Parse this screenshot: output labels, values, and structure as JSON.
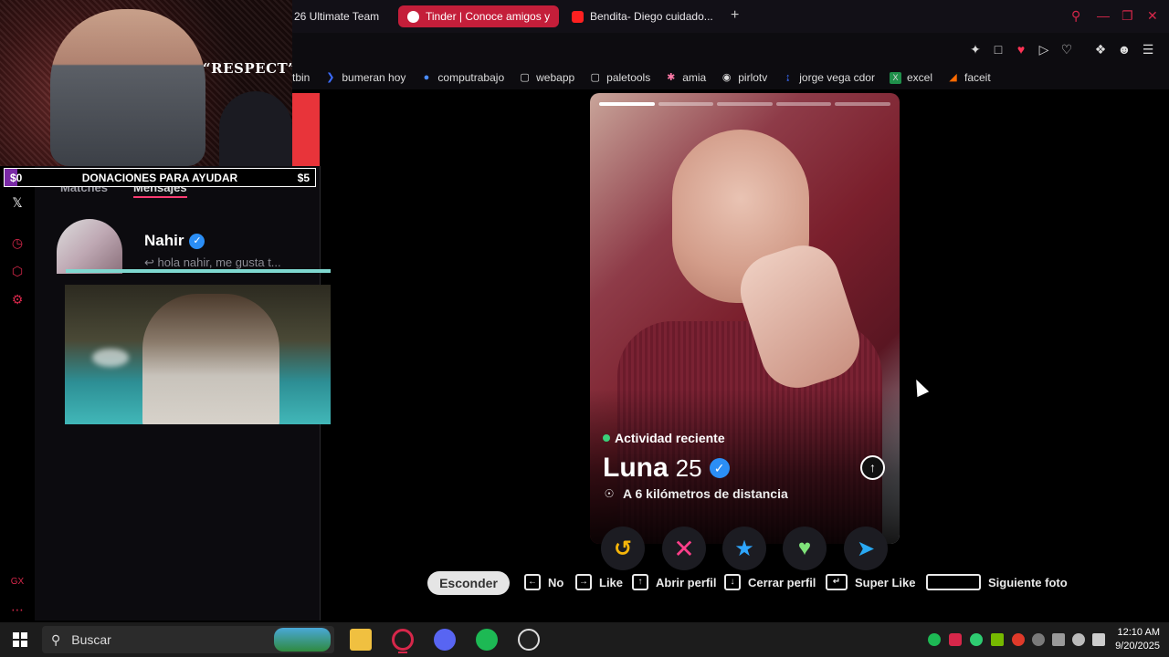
{
  "browser": {
    "tabs": [
      {
        "label": "26 Ultimate Team",
        "active": false
      },
      {
        "label": "Tinder | Conoce amigos y",
        "active": true
      },
      {
        "label": "Bendita- Diego cuidado...",
        "active": false
      }
    ],
    "new_tab_label": "+",
    "bookmarks": [
      "tbin",
      "bumeran hoy",
      "computrabajo",
      "webapp",
      "paletools",
      "amia",
      "pirlotv",
      "jorge vega cdor",
      "excel",
      "faceit"
    ]
  },
  "stream": {
    "overlay_caption": "“RESPECT”",
    "donation_left": "$0",
    "donation_title": "DONACIONES PARA AYUDAR",
    "donation_right": "$5",
    "donation_progress": 0.0
  },
  "sidebar": {
    "tab_matches": "Matches",
    "tab_messages": "Mensajes",
    "match": {
      "name": "Nahir",
      "preview": "↩ hola nahir, me gusta t..."
    }
  },
  "profile": {
    "activity": "Actividad reciente",
    "name": "Luna",
    "age": "25",
    "distance": "A 6 kilómetros de distancia",
    "photo_count": 5,
    "current_photo": 1
  },
  "shortcuts": {
    "hide": "Esconder",
    "no": "No",
    "like": "Like",
    "open_profile": "Abrir perfil",
    "close_profile": "Cerrar perfil",
    "super_like": "Super Like",
    "next_photo": "Siguiente foto"
  },
  "taskbar": {
    "search_placeholder": "Buscar",
    "time": "12:10 AM",
    "date": "9/20/2025"
  },
  "colors": {
    "accent": "#d6274a",
    "tinder": "#fe3c72",
    "teal": "#7fd8d0"
  }
}
